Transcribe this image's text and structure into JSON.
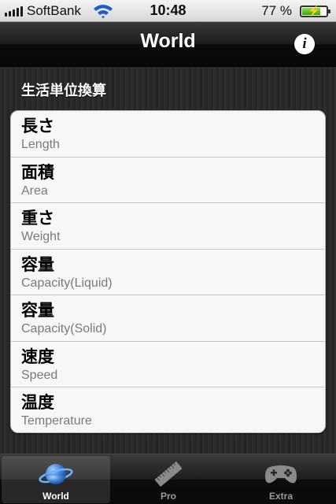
{
  "status_bar": {
    "carrier": "SoftBank",
    "time": "10:48",
    "battery_percent": "77 %",
    "battery_level": 0.77
  },
  "nav_bar": {
    "title": "World",
    "info_label": "i"
  },
  "section": {
    "header": "生活単位換算"
  },
  "list": {
    "items": [
      {
        "title": "長さ",
        "subtitle": "Length"
      },
      {
        "title": "面積",
        "subtitle": "Area"
      },
      {
        "title": "重さ",
        "subtitle": "Weight"
      },
      {
        "title": "容量",
        "subtitle": "Capacity(Liquid)"
      },
      {
        "title": "容量",
        "subtitle": "Capacity(Solid)"
      },
      {
        "title": "速度",
        "subtitle": "Speed"
      },
      {
        "title": "温度",
        "subtitle": "Temperature"
      }
    ]
  },
  "tab_bar": {
    "tabs": [
      {
        "label": "World",
        "icon": "planet-icon",
        "selected": true
      },
      {
        "label": "Pro",
        "icon": "ruler-icon",
        "selected": false
      },
      {
        "label": "Extra",
        "icon": "gamepad-icon",
        "selected": false
      }
    ]
  },
  "colors": {
    "accent_blue": "#3d7fd6",
    "battery_green": "#4caf1a"
  }
}
